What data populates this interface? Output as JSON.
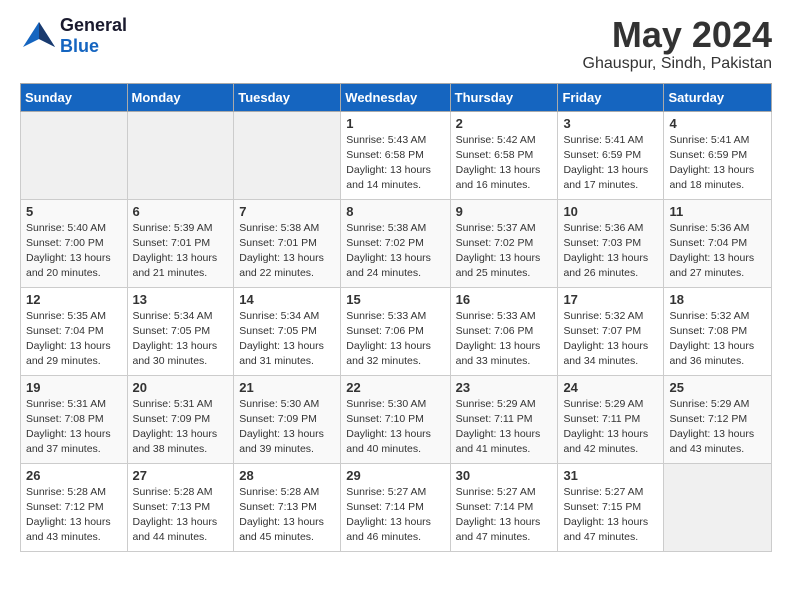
{
  "header": {
    "logo_general": "General",
    "logo_blue": "Blue",
    "month": "May 2024",
    "location": "Ghauspur, Sindh, Pakistan"
  },
  "days_of_week": [
    "Sunday",
    "Monday",
    "Tuesday",
    "Wednesday",
    "Thursday",
    "Friday",
    "Saturday"
  ],
  "weeks": [
    [
      {
        "day": "",
        "info": ""
      },
      {
        "day": "",
        "info": ""
      },
      {
        "day": "",
        "info": ""
      },
      {
        "day": "1",
        "info": "Sunrise: 5:43 AM\nSunset: 6:58 PM\nDaylight: 13 hours\nand 14 minutes."
      },
      {
        "day": "2",
        "info": "Sunrise: 5:42 AM\nSunset: 6:58 PM\nDaylight: 13 hours\nand 16 minutes."
      },
      {
        "day": "3",
        "info": "Sunrise: 5:41 AM\nSunset: 6:59 PM\nDaylight: 13 hours\nand 17 minutes."
      },
      {
        "day": "4",
        "info": "Sunrise: 5:41 AM\nSunset: 6:59 PM\nDaylight: 13 hours\nand 18 minutes."
      }
    ],
    [
      {
        "day": "5",
        "info": "Sunrise: 5:40 AM\nSunset: 7:00 PM\nDaylight: 13 hours\nand 20 minutes."
      },
      {
        "day": "6",
        "info": "Sunrise: 5:39 AM\nSunset: 7:01 PM\nDaylight: 13 hours\nand 21 minutes."
      },
      {
        "day": "7",
        "info": "Sunrise: 5:38 AM\nSunset: 7:01 PM\nDaylight: 13 hours\nand 22 minutes."
      },
      {
        "day": "8",
        "info": "Sunrise: 5:38 AM\nSunset: 7:02 PM\nDaylight: 13 hours\nand 24 minutes."
      },
      {
        "day": "9",
        "info": "Sunrise: 5:37 AM\nSunset: 7:02 PM\nDaylight: 13 hours\nand 25 minutes."
      },
      {
        "day": "10",
        "info": "Sunrise: 5:36 AM\nSunset: 7:03 PM\nDaylight: 13 hours\nand 26 minutes."
      },
      {
        "day": "11",
        "info": "Sunrise: 5:36 AM\nSunset: 7:04 PM\nDaylight: 13 hours\nand 27 minutes."
      }
    ],
    [
      {
        "day": "12",
        "info": "Sunrise: 5:35 AM\nSunset: 7:04 PM\nDaylight: 13 hours\nand 29 minutes."
      },
      {
        "day": "13",
        "info": "Sunrise: 5:34 AM\nSunset: 7:05 PM\nDaylight: 13 hours\nand 30 minutes."
      },
      {
        "day": "14",
        "info": "Sunrise: 5:34 AM\nSunset: 7:05 PM\nDaylight: 13 hours\nand 31 minutes."
      },
      {
        "day": "15",
        "info": "Sunrise: 5:33 AM\nSunset: 7:06 PM\nDaylight: 13 hours\nand 32 minutes."
      },
      {
        "day": "16",
        "info": "Sunrise: 5:33 AM\nSunset: 7:06 PM\nDaylight: 13 hours\nand 33 minutes."
      },
      {
        "day": "17",
        "info": "Sunrise: 5:32 AM\nSunset: 7:07 PM\nDaylight: 13 hours\nand 34 minutes."
      },
      {
        "day": "18",
        "info": "Sunrise: 5:32 AM\nSunset: 7:08 PM\nDaylight: 13 hours\nand 36 minutes."
      }
    ],
    [
      {
        "day": "19",
        "info": "Sunrise: 5:31 AM\nSunset: 7:08 PM\nDaylight: 13 hours\nand 37 minutes."
      },
      {
        "day": "20",
        "info": "Sunrise: 5:31 AM\nSunset: 7:09 PM\nDaylight: 13 hours\nand 38 minutes."
      },
      {
        "day": "21",
        "info": "Sunrise: 5:30 AM\nSunset: 7:09 PM\nDaylight: 13 hours\nand 39 minutes."
      },
      {
        "day": "22",
        "info": "Sunrise: 5:30 AM\nSunset: 7:10 PM\nDaylight: 13 hours\nand 40 minutes."
      },
      {
        "day": "23",
        "info": "Sunrise: 5:29 AM\nSunset: 7:11 PM\nDaylight: 13 hours\nand 41 minutes."
      },
      {
        "day": "24",
        "info": "Sunrise: 5:29 AM\nSunset: 7:11 PM\nDaylight: 13 hours\nand 42 minutes."
      },
      {
        "day": "25",
        "info": "Sunrise: 5:29 AM\nSunset: 7:12 PM\nDaylight: 13 hours\nand 43 minutes."
      }
    ],
    [
      {
        "day": "26",
        "info": "Sunrise: 5:28 AM\nSunset: 7:12 PM\nDaylight: 13 hours\nand 43 minutes."
      },
      {
        "day": "27",
        "info": "Sunrise: 5:28 AM\nSunset: 7:13 PM\nDaylight: 13 hours\nand 44 minutes."
      },
      {
        "day": "28",
        "info": "Sunrise: 5:28 AM\nSunset: 7:13 PM\nDaylight: 13 hours\nand 45 minutes."
      },
      {
        "day": "29",
        "info": "Sunrise: 5:27 AM\nSunset: 7:14 PM\nDaylight: 13 hours\nand 46 minutes."
      },
      {
        "day": "30",
        "info": "Sunrise: 5:27 AM\nSunset: 7:14 PM\nDaylight: 13 hours\nand 47 minutes."
      },
      {
        "day": "31",
        "info": "Sunrise: 5:27 AM\nSunset: 7:15 PM\nDaylight: 13 hours\nand 47 minutes."
      },
      {
        "day": "",
        "info": ""
      }
    ]
  ]
}
